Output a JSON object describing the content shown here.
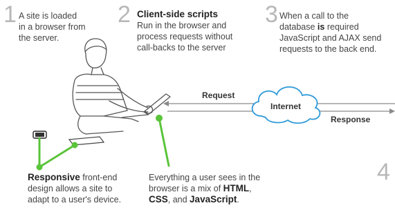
{
  "steps": {
    "s1": {
      "number": "1",
      "line1": "A site is loaded",
      "line2": "in a browser from",
      "line3": "the server."
    },
    "s2": {
      "number": "2",
      "heading": "Client-side scripts",
      "line1": "Run in the browser and",
      "line2": "process requests without",
      "line3": "call-backs to the server"
    },
    "s3": {
      "number": "3",
      "line1": "When a call to the",
      "line2_pre": "database ",
      "line2_bold": "is",
      "line2_post": " required",
      "line3": "JavaScript and AJAX send",
      "line4": "requests to the back end."
    },
    "s4": {
      "number": "4"
    }
  },
  "flow": {
    "request": "Request",
    "response": "Response",
    "internet": "Internet"
  },
  "notes": {
    "responsive": {
      "bold": "Responsive",
      "rest": " front-end",
      "line2": "design allows a site to",
      "line3": "adapt to a user's device."
    },
    "mix": {
      "line1": "Everything a user sees in the",
      "line2_pre": "browser is a mix of ",
      "html": "HTML",
      "comma": ",",
      "css": "CSS",
      "and": ", and ",
      "js": "JavaScript",
      "end": "."
    }
  },
  "colors": {
    "accent_green": "#5ac43a",
    "cloud_blue": "#2e9ad8",
    "line_gray": "#8a8a8a",
    "number_gray": "#b8b8b8"
  }
}
